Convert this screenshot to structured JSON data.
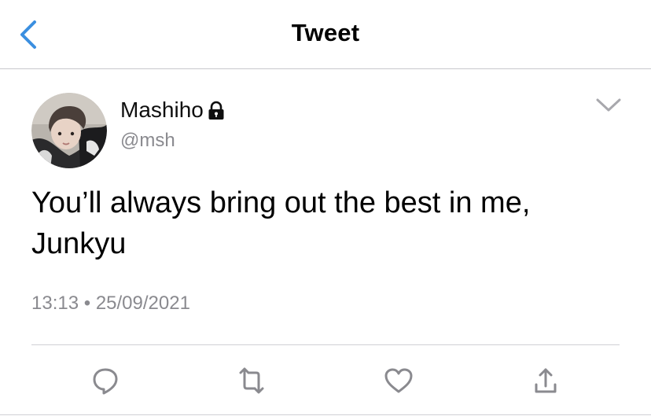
{
  "header": {
    "title": "Tweet",
    "back_icon": "chevron-left-icon"
  },
  "tweet": {
    "author": {
      "display_name": "Mashiho",
      "handle": "@msh",
      "protected": true
    },
    "text_line1": "You’ll always bring out the best in me,",
    "text_line2": "Junkyu",
    "time": "13:13",
    "separator": "•",
    "date": "25/09/2021"
  },
  "actions": [
    {
      "name": "reply",
      "icon": "reply-icon"
    },
    {
      "name": "retweet",
      "icon": "retweet-icon"
    },
    {
      "name": "like",
      "icon": "heart-icon"
    },
    {
      "name": "share",
      "icon": "share-icon"
    }
  ],
  "colors": {
    "accent": "#1d9bf0",
    "back_chevron": "#3b8fe0",
    "secondary_text": "#8a8a8f",
    "icon_gray": "#8a8a8f",
    "divider": "#d0d0d4"
  }
}
